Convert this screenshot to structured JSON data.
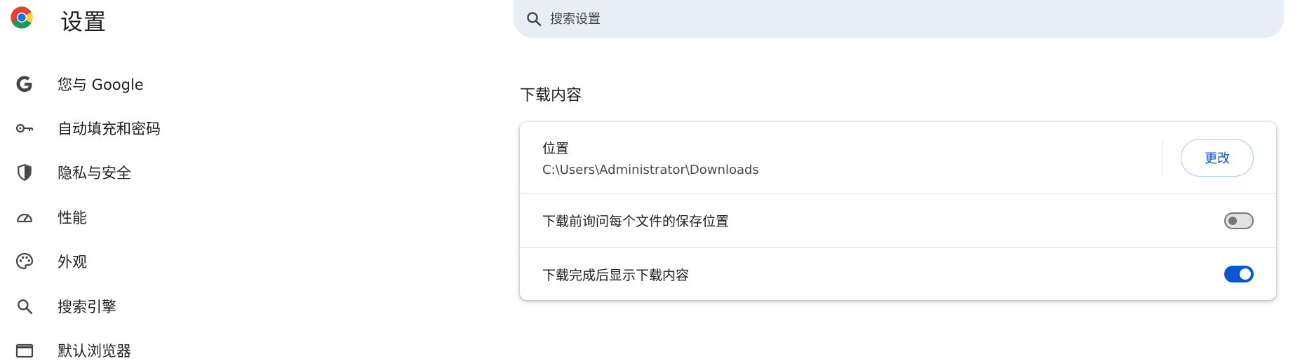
{
  "header": {
    "title": "设置",
    "logo_icon": "chrome-logo-icon"
  },
  "search": {
    "placeholder": "搜索设置",
    "value": "",
    "icon": "search-icon"
  },
  "sidebar": {
    "items": [
      {
        "label": "您与 Google",
        "icon": "google-g-icon"
      },
      {
        "label": "自动填充和密码",
        "icon": "key-icon"
      },
      {
        "label": "隐私与安全",
        "icon": "shield-icon"
      },
      {
        "label": "性能",
        "icon": "speedometer-icon"
      },
      {
        "label": "外观",
        "icon": "palette-icon"
      },
      {
        "label": "搜索引擎",
        "icon": "search-icon"
      },
      {
        "label": "默认浏览器",
        "icon": "browser-window-icon"
      }
    ]
  },
  "downloads": {
    "section_title": "下载内容",
    "location": {
      "label": "位置",
      "path": "C:\\Users\\Administrator\\Downloads",
      "change_label": "更改"
    },
    "ask_where_to_save": {
      "label": "下载前询问每个文件的保存位置",
      "enabled": false
    },
    "show_when_done": {
      "label": "下载完成后显示下载内容",
      "enabled": true
    }
  },
  "colors": {
    "accent": "#0b57d0",
    "search_bg": "#e9eef6",
    "icon_gray": "#444746"
  }
}
